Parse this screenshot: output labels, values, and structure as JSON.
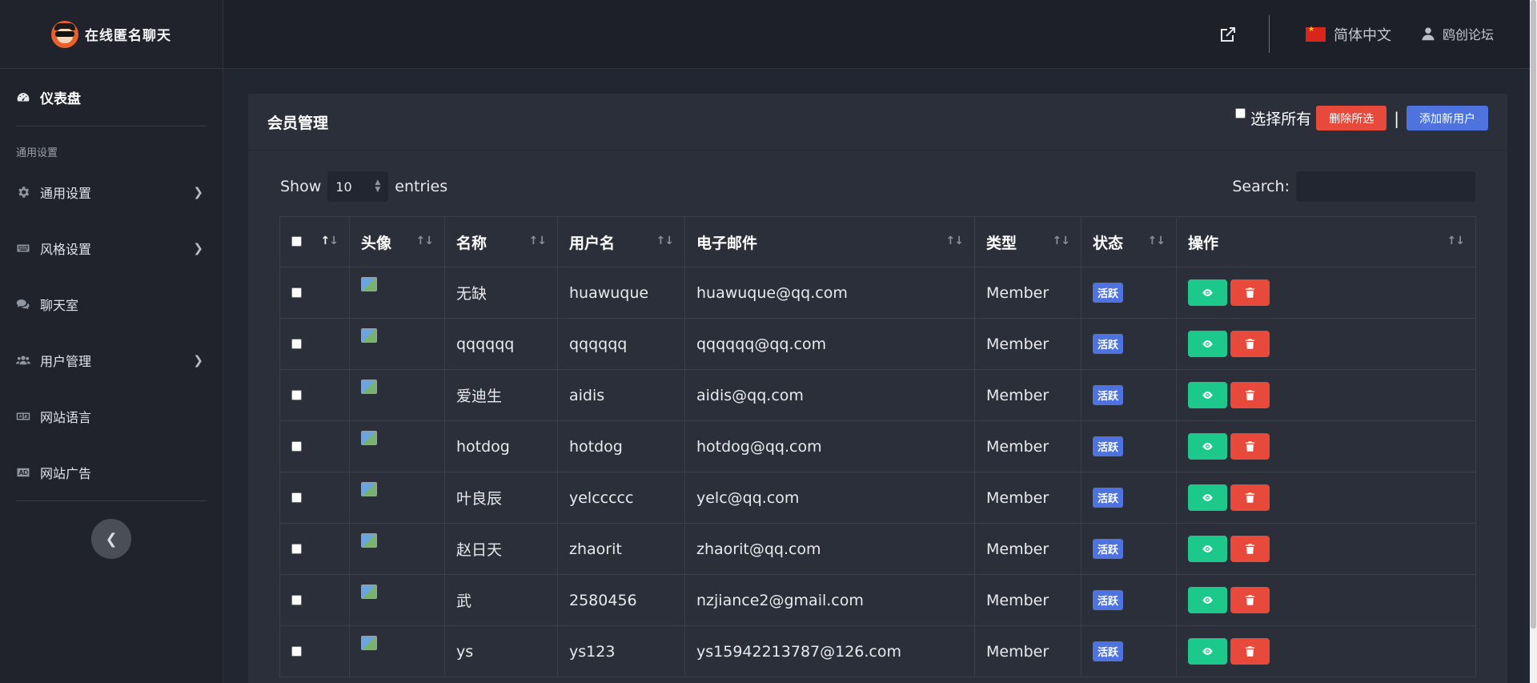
{
  "brand": {
    "name": "在线匿名聊天"
  },
  "sidebar": {
    "dashboard": "仪表盘",
    "section_title": "通用设置",
    "items": [
      {
        "label": "通用设置",
        "icon": "gear-icon",
        "has_children": true
      },
      {
        "label": "风格设置",
        "icon": "keyboard-icon",
        "has_children": true
      },
      {
        "label": "聊天室",
        "icon": "comments-icon",
        "has_children": false
      },
      {
        "label": "用户管理",
        "icon": "users-icon",
        "has_children": true
      },
      {
        "label": "网站语言",
        "icon": "language-icon",
        "has_children": false
      },
      {
        "label": "网站广告",
        "icon": "ad-icon",
        "has_children": false
      }
    ]
  },
  "topbar": {
    "language": "简体中文",
    "user": "鸥创论坛"
  },
  "card": {
    "title": "会员管理",
    "select_all": "选择所有",
    "delete_selected": "删除所选",
    "separator": "|",
    "add_user": "添加新用户"
  },
  "table_controls": {
    "show": "Show",
    "entries_value": "10",
    "entries": "entries",
    "search_label": "Search:"
  },
  "table": {
    "columns": [
      "头像",
      "名称",
      "用户名",
      "电子邮件",
      "类型",
      "状态",
      "操作"
    ],
    "rows": [
      {
        "name": "无缺",
        "username": "huawuque",
        "email": "huawuque@qq.com",
        "type": "Member",
        "status": "活跃"
      },
      {
        "name": "qqqqqq",
        "username": "qqqqqq",
        "email": "qqqqqq@qq.com",
        "type": "Member",
        "status": "活跃"
      },
      {
        "name": "爱迪生",
        "username": "aidis",
        "email": "aidis@qq.com",
        "type": "Member",
        "status": "活跃"
      },
      {
        "name": "hotdog",
        "username": "hotdog",
        "email": "hotdog@qq.com",
        "type": "Member",
        "status": "活跃"
      },
      {
        "name": "叶良辰",
        "username": "yelccccc",
        "email": "yelc@qq.com",
        "type": "Member",
        "status": "活跃"
      },
      {
        "name": "赵日天",
        "username": "zhaorit",
        "email": "zhaorit@qq.com",
        "type": "Member",
        "status": "活跃"
      },
      {
        "name": "武",
        "username": "2580456",
        "email": "nzjiance2@gmail.com",
        "type": "Member",
        "status": "活跃"
      },
      {
        "name": "ys",
        "username": "ys123",
        "email": "ys15942213787@126.com",
        "type": "Member",
        "status": "活跃"
      }
    ]
  }
}
